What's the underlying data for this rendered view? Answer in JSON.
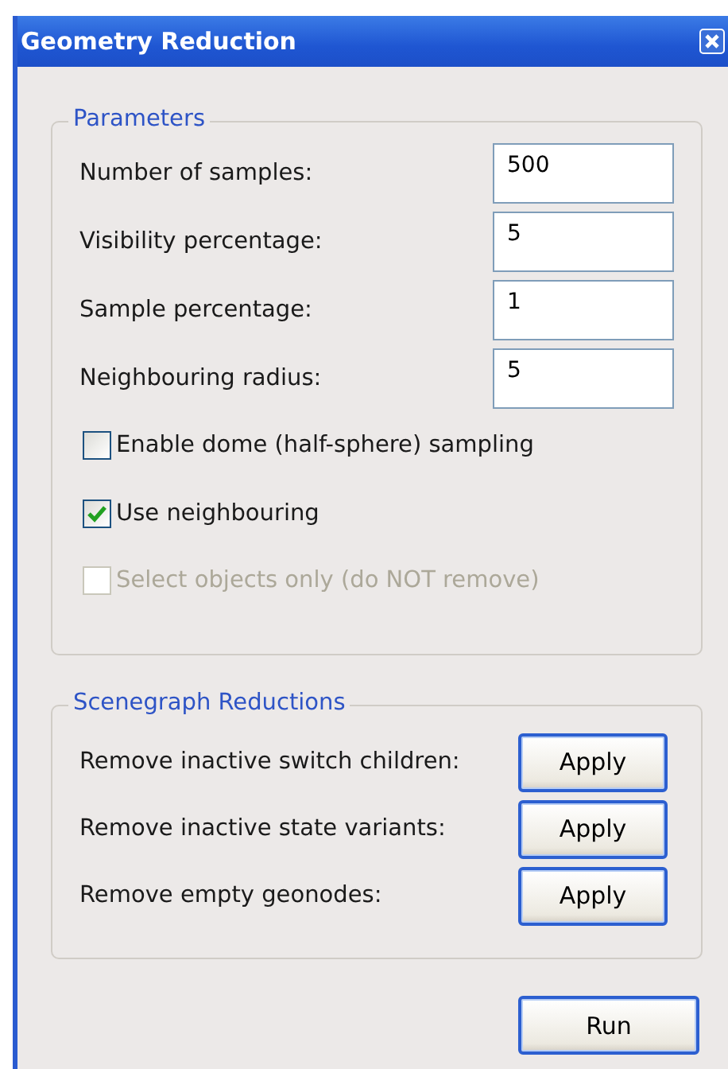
{
  "window": {
    "title": "Geometry Reduction"
  },
  "parameters": {
    "title": "Parameters",
    "fields": [
      {
        "label": "Number of samples:",
        "value": "500"
      },
      {
        "label": "Visibility percentage:",
        "value": "5"
      },
      {
        "label": "Sample percentage:",
        "value": "1"
      },
      {
        "label": "Neighbouring radius:",
        "value": "5"
      }
    ],
    "checkboxes": [
      {
        "label": "Enable dome (half-sphere) sampling",
        "checked": false,
        "disabled": false
      },
      {
        "label": "Use neighbouring",
        "checked": true,
        "disabled": false
      },
      {
        "label": "Select objects only (do NOT remove)",
        "checked": false,
        "disabled": true
      }
    ]
  },
  "reductions": {
    "title": "Scenegraph Reductions",
    "rows": [
      {
        "label": "Remove inactive switch children:",
        "button": "Apply"
      },
      {
        "label": "Remove inactive state variants:",
        "button": "Apply"
      },
      {
        "label": "Remove empty geonodes:",
        "button": "Apply"
      }
    ]
  },
  "run_button": "Run"
}
